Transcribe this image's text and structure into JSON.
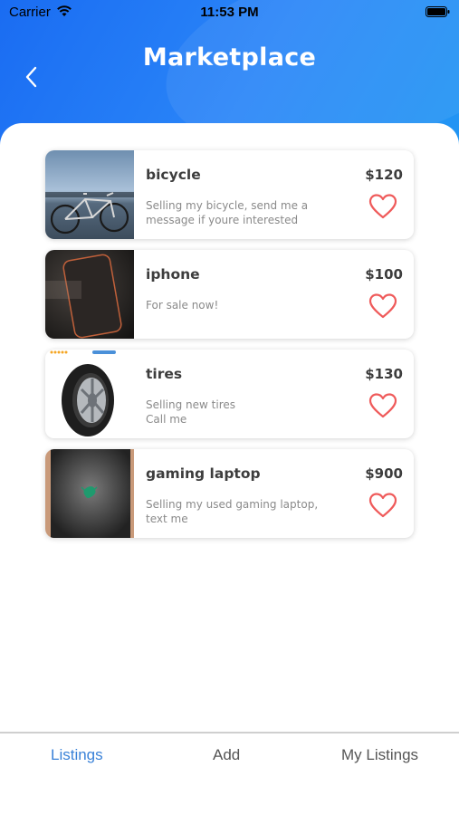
{
  "status_bar": {
    "carrier": "Carrier",
    "time": "11:53 PM"
  },
  "header": {
    "title": "Marketplace",
    "back_icon": "chevron-left-icon"
  },
  "listings": [
    {
      "name": "bicycle",
      "description": "Selling my bicycle, send me a\nmessage if youre interested",
      "price": "$120",
      "favorite_icon": "heart-outline-icon"
    },
    {
      "name": "iphone",
      "description": "For sale now!",
      "price": "$100",
      "favorite_icon": "heart-outline-icon"
    },
    {
      "name": "tires",
      "description": "Selling new tires\nCall me",
      "price": "$130",
      "favorite_icon": "heart-outline-icon"
    },
    {
      "name": "gaming laptop",
      "description": "Selling my used gaming laptop,\ntext me",
      "price": "$900",
      "favorite_icon": "heart-outline-icon"
    }
  ],
  "tab_bar": {
    "tabs": [
      {
        "label": "Listings",
        "active": true
      },
      {
        "label": "Add",
        "active": false
      },
      {
        "label": "My Listings",
        "active": false
      }
    ]
  },
  "colors": {
    "header_gradient_start": "#1a6cf2",
    "header_gradient_end": "#2196f3",
    "heart": "#ef5a5a",
    "active_tab": "#3a82d8"
  }
}
